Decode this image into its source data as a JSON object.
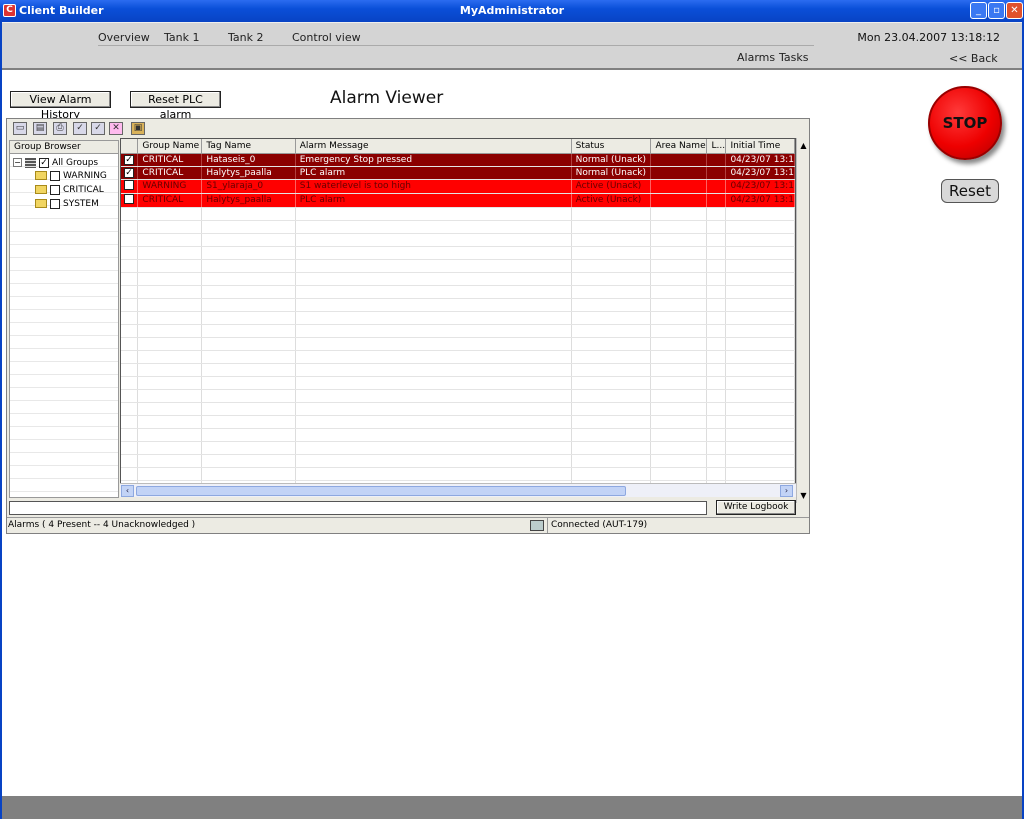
{
  "window": {
    "app_title": "Client Builder",
    "title": "MyAdministrator",
    "minimize": "_",
    "restore": "▫",
    "close": "✕"
  },
  "nav": {
    "items": [
      "Overview",
      "Tank 1",
      "Tank 2",
      "Control view"
    ],
    "datetime": "Mon 23.04.2007 13:18:12",
    "alarms": "Alarms",
    "tasks": "Tasks",
    "back": "<< Back"
  },
  "buttons": {
    "view_history": "View Alarm History",
    "reset_plc": "Reset PLC alarm",
    "stop": "STOP",
    "reset": "Reset",
    "write_logbook": "Write Logbook"
  },
  "page_title": "Alarm Viewer",
  "group_browser": {
    "header": "Group Browser",
    "root": "All Groups",
    "groups": [
      "WARNING",
      "CRITICAL",
      "SYSTEM"
    ]
  },
  "alarm_table": {
    "columns": [
      "",
      "Group Name",
      "Tag Name",
      "Alarm Message",
      "Status",
      "Area Name",
      "L...",
      "Initial Time"
    ],
    "rows": [
      {
        "checked": true,
        "group": "CRITICAL",
        "tag": "Hataseis_0",
        "message": "Emergency Stop pressed",
        "status": "Normal (Unack)",
        "area": "",
        "level": "",
        "time": "04/23/07 13:1"
      },
      {
        "checked": true,
        "group": "CRITICAL",
        "tag": "Halytys_paalla",
        "message": "PLC alarm",
        "status": "Normal (Unack)",
        "area": "",
        "level": "",
        "time": "04/23/07 13:1"
      },
      {
        "checked": false,
        "group": "WARNING",
        "tag": "S1_ylaraja_0",
        "message": "S1 waterlevel is too high",
        "status": "Active (Unack)",
        "area": "",
        "level": "",
        "time": "04/23/07 13:1"
      },
      {
        "checked": false,
        "group": "CRITICAL",
        "tag": "Halytys_paalla",
        "message": "PLC alarm",
        "status": "Active (Unack)",
        "area": "",
        "level": "",
        "time": "04/23/07 13:1"
      }
    ]
  },
  "status": {
    "alarms": "Alarms  ( 4 Present -- 4 Unacknowledged )",
    "connection": "Connected (AUT-179)"
  },
  "colors": {
    "acked_row": "#8b0000",
    "active_row": "#ff0000",
    "stop_button": "#ee0000"
  }
}
